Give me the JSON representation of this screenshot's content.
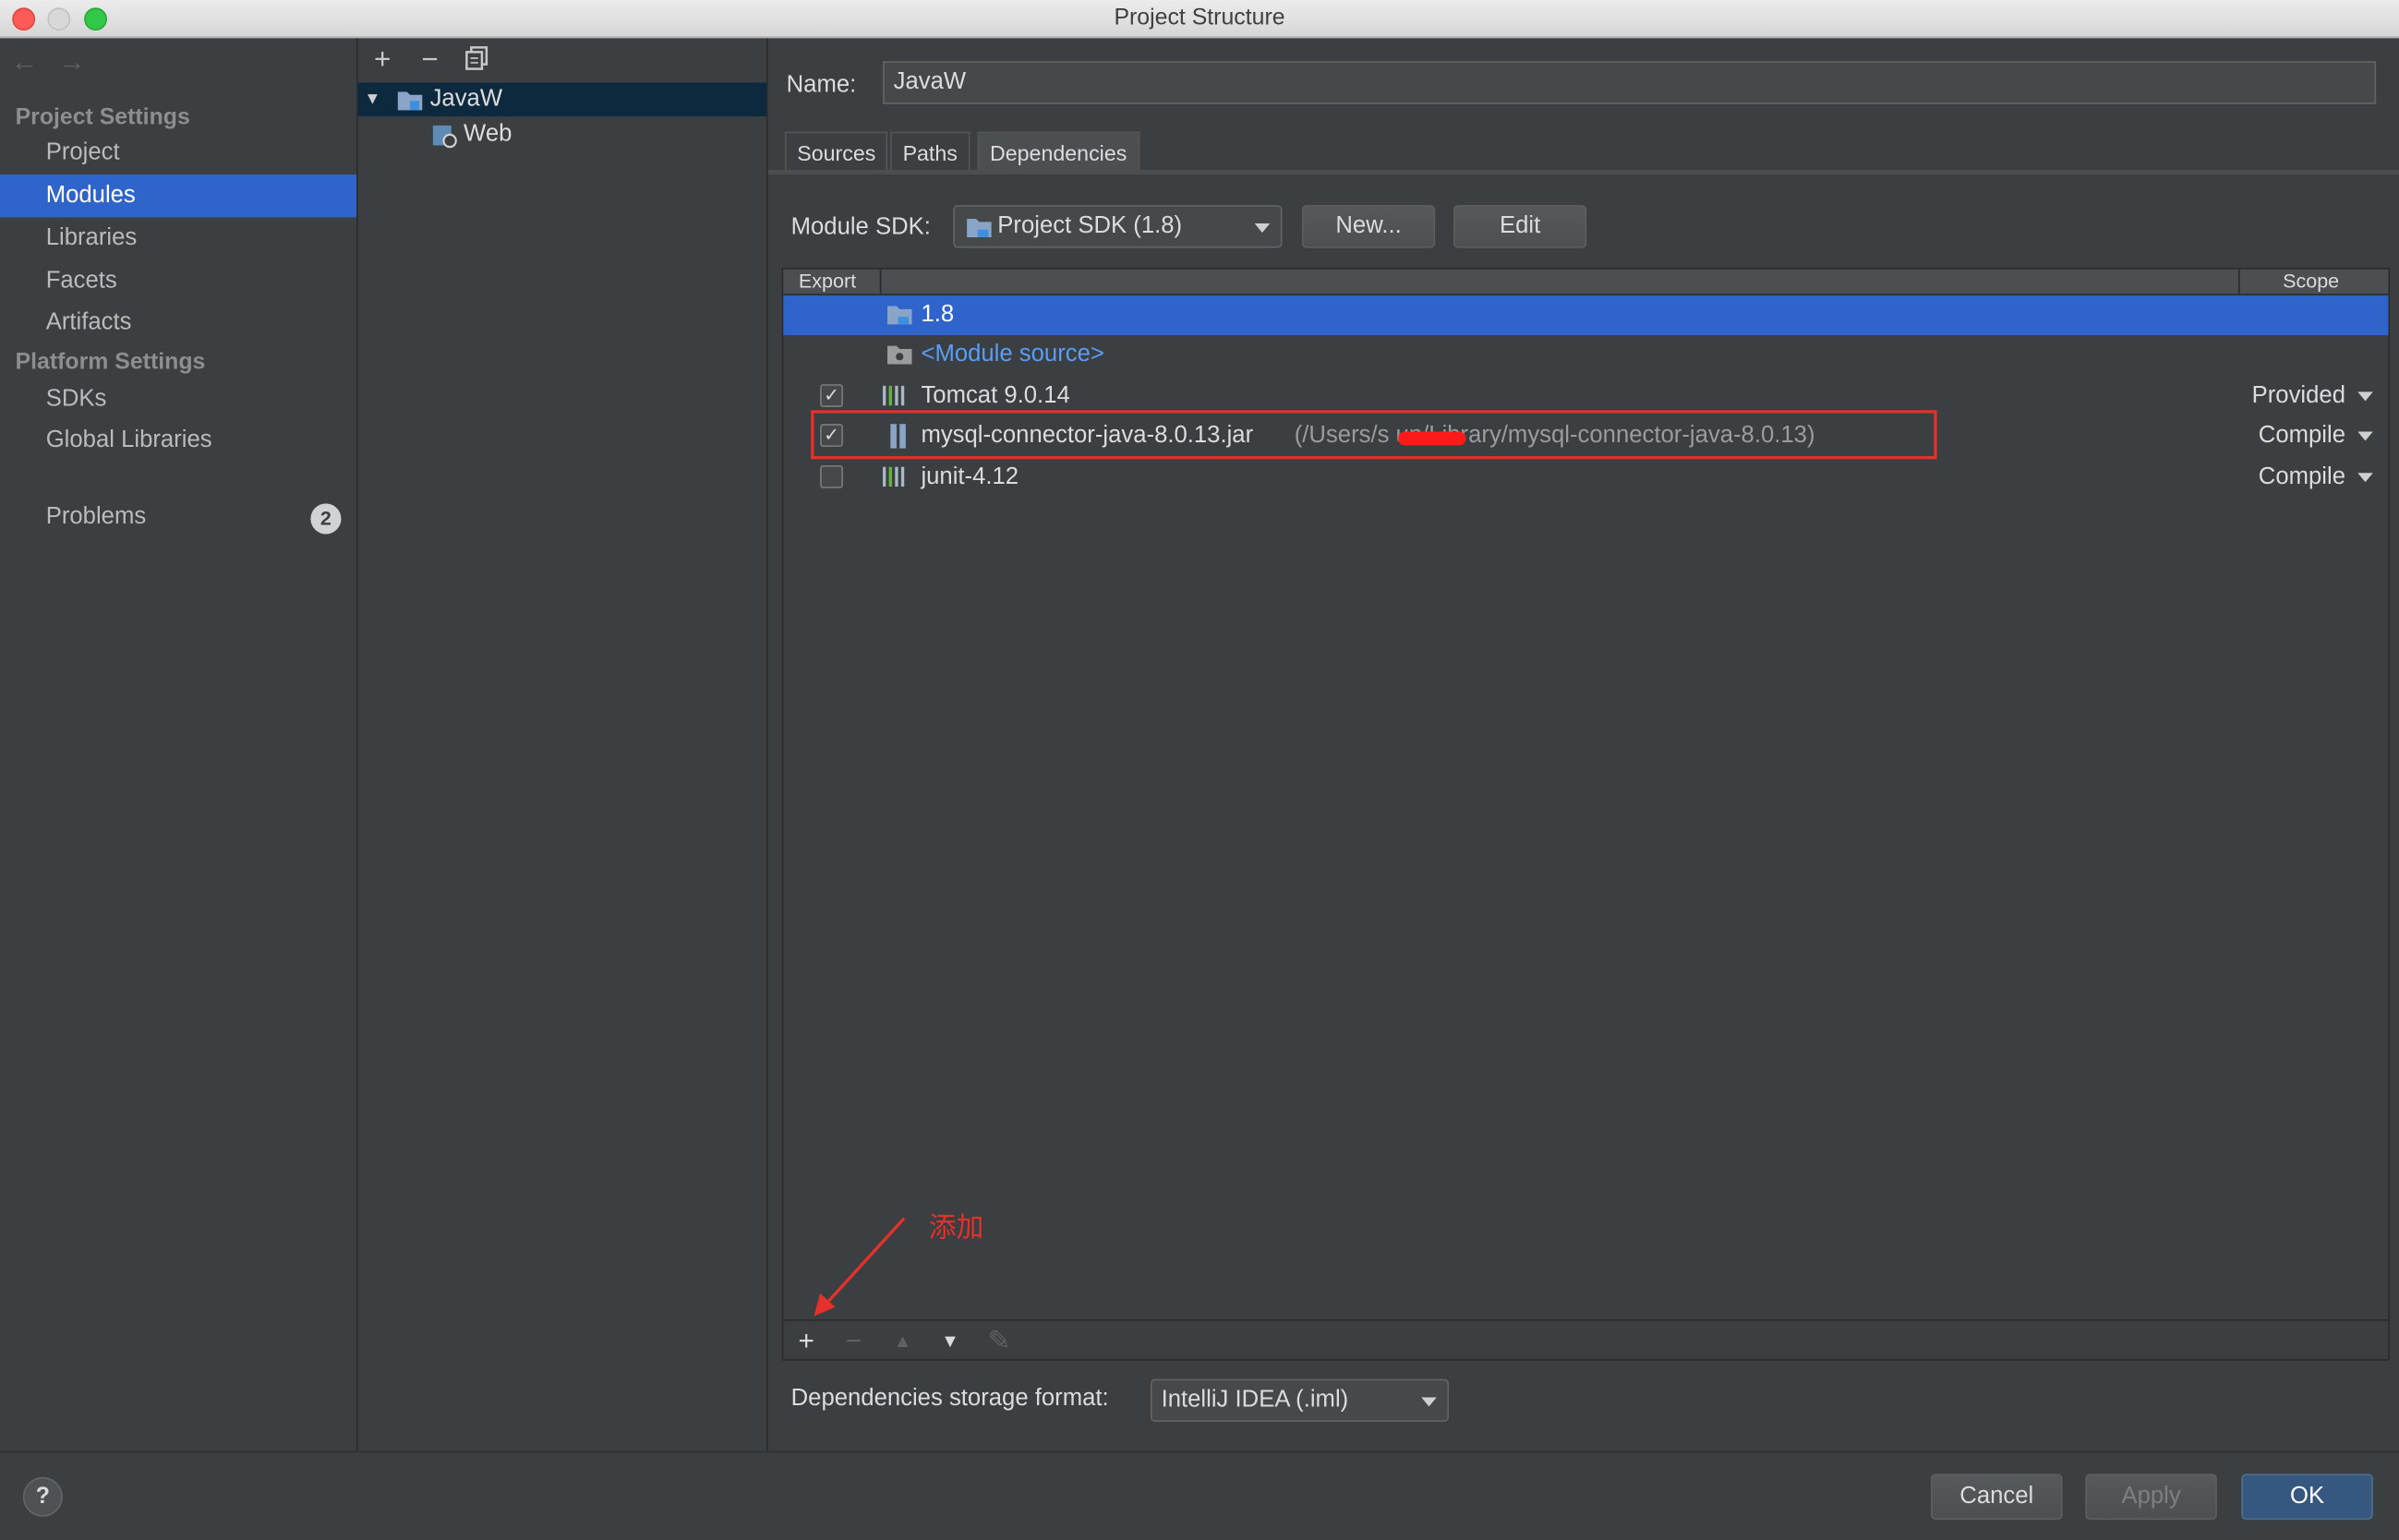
{
  "window": {
    "title": "Project Structure"
  },
  "sidebar": {
    "back_icon": "←",
    "forward_icon": "→",
    "project_settings_header": "Project Settings",
    "project_settings_items": [
      {
        "label": "Project",
        "selected": false
      },
      {
        "label": "Modules",
        "selected": true
      },
      {
        "label": "Libraries",
        "selected": false
      },
      {
        "label": "Facets",
        "selected": false
      },
      {
        "label": "Artifacts",
        "selected": false
      }
    ],
    "platform_settings_header": "Platform Settings",
    "platform_settings_items": [
      {
        "label": "SDKs"
      },
      {
        "label": "Global Libraries"
      }
    ],
    "problems": {
      "label": "Problems",
      "count": "2"
    }
  },
  "module_tree": {
    "toolbar": {
      "add": "+",
      "remove": "−",
      "copy": "copy-icon"
    },
    "nodes": [
      {
        "label": "JavaW",
        "expanded": true,
        "selected": true
      },
      {
        "label": "Web",
        "child": true
      }
    ]
  },
  "module": {
    "name_label": "Name:",
    "name_value": "JavaW",
    "tabs": [
      {
        "label": "Sources"
      },
      {
        "label": "Paths"
      },
      {
        "label": "Dependencies",
        "active": true
      }
    ],
    "sdk_label": "Module SDK:",
    "sdk_value": "Project SDK (1.8)",
    "new_button": "New...",
    "edit_button": "Edit"
  },
  "dependencies": {
    "columns": {
      "export": "Export",
      "scope": "Scope"
    },
    "rows": [
      {
        "name": "1.8",
        "checkbox": null,
        "scope": "",
        "selected": true
      },
      {
        "name": "<Module source>",
        "checkbox": null,
        "scope": ""
      },
      {
        "name": "Tomcat 9.0.14",
        "checkbox": true,
        "scope": "Provided"
      },
      {
        "name": "mysql-connector-java-8.0.13.jar",
        "path": "(/Users/s       un/Library/mysql-connector-java-8.0.13)",
        "checkbox": true,
        "scope": "Compile",
        "highlighted": true
      },
      {
        "name": "junit-4.12",
        "checkbox": false,
        "scope": "Compile"
      }
    ],
    "toolbar": {
      "add": "+",
      "remove": "−",
      "up": "▲",
      "down": "▼",
      "edit": "✎"
    },
    "storage_label": "Dependencies storage format:",
    "storage_value": "IntelliJ IDEA (.iml)"
  },
  "annotation": {
    "text": "添加",
    "color": "#e4312b"
  },
  "footer": {
    "help": "?",
    "cancel": "Cancel",
    "apply": "Apply",
    "ok": "OK"
  },
  "colors": {
    "selection": "#2f65ca",
    "background": "#3c3f41",
    "link": "#589df6"
  }
}
